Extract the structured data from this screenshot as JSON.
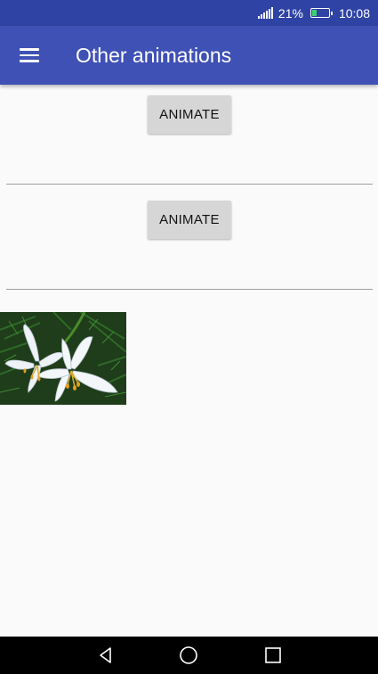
{
  "status_bar": {
    "battery_percent": "21%",
    "time": "10:08",
    "icons": [
      "signal-icon",
      "battery-icon"
    ]
  },
  "app_bar": {
    "title": "Other animations",
    "menu_icon": "hamburger-menu-icon"
  },
  "main": {
    "buttons": [
      {
        "label": "ANIMATE"
      },
      {
        "label": "ANIMATE"
      }
    ],
    "image": {
      "subject": "white lily flowers"
    }
  },
  "nav_bar": {
    "icons": [
      "back-icon",
      "home-icon",
      "recents-icon"
    ]
  }
}
